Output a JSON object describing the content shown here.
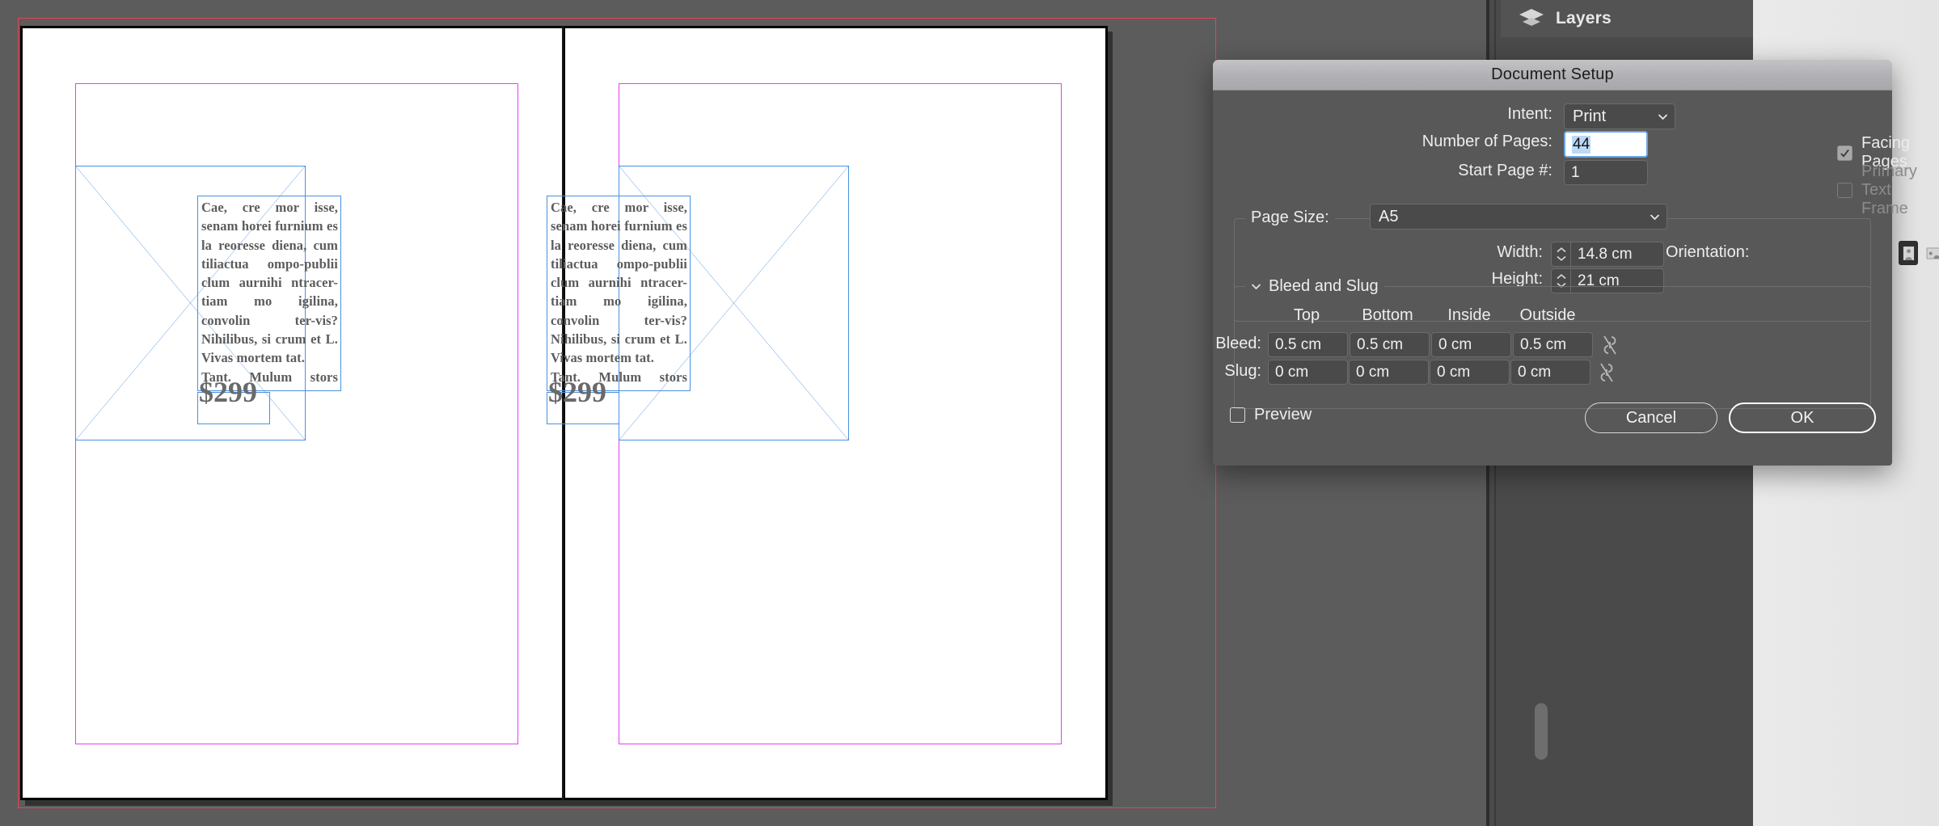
{
  "app": {
    "panel": {
      "title": "Layers",
      "icon": "layers-icon"
    }
  },
  "document": {
    "pages": [
      {
        "body_paragraph_1": "Cae, cre mor isse, senam horei furnium es la reoresse diena, cum tiliactua ompo-publii clum aurnihi ntracer-tiam mo igilina, convolin ter-vis? Nihilibus, si crum et L. Vivas mortem tat.",
        "body_paragraph_2": "Tant. Mulum stors fuere, vit; num atroximus ficipiorunu qua nius iam, condium mu-rarit abest? quam ac re et; huiur praectus An sereis.M. Nihilin Itatum Romnost iqu-is. Fui sendacta nu vit, tam orarei patquem quastra edi-endetiam mo",
        "price": "$299"
      },
      {
        "body_paragraph_1": "Cae, cre mor isse, senam horei furnium es la reoresse diena, cum tiliactua ompo-publii clum aurnihi ntracer-tiam mo igilina, convolin ter-vis? Nihilibus, si crum et L. Vivas mortem tat.",
        "body_paragraph_2": "Tant. Mulum stors fuere, vit; num atroximus ficipiorunu qua nius iam, condium mu-rarit abest? quam ac re et; huiur praectus An sereis.M. Nihilin Itatum Romnost iqu-is. Fui sendacta nu vit, tam orarei patquem quastra edi-endetiam mo",
        "price": "$299"
      }
    ],
    "guide_colors": {
      "bleed": "#ef4056",
      "margin": "#e83cf0",
      "frame": "#4a90e2"
    }
  },
  "dialog": {
    "title": "Document Setup",
    "intent": {
      "label": "Intent:",
      "value": "Print"
    },
    "number_of_pages": {
      "label": "Number of Pages:",
      "value": "44"
    },
    "facing_pages": {
      "label": "Facing Pages",
      "checked": true
    },
    "start_page": {
      "label": "Start Page #:",
      "value": "1"
    },
    "primary_text_frame": {
      "label": "Primary Text Frame",
      "checked": false
    },
    "page_size": {
      "label": "Page Size:",
      "value": "A5"
    },
    "width": {
      "label": "Width:",
      "value": "14.8 cm"
    },
    "height": {
      "label": "Height:",
      "value": "21 cm"
    },
    "orientation": {
      "label": "Orientation:",
      "portrait_selected": true
    },
    "bleed_and_slug": {
      "legend": "Bleed and Slug",
      "columns": [
        "Top",
        "Bottom",
        "Inside",
        "Outside"
      ],
      "rows": [
        {
          "label": "Bleed:",
          "values": [
            "0.5 cm",
            "0.5 cm",
            "0 cm",
            "0.5 cm"
          ]
        },
        {
          "label": "Slug:",
          "values": [
            "0 cm",
            "0 cm",
            "0 cm",
            "0 cm"
          ]
        }
      ]
    },
    "preview": {
      "label": "Preview",
      "checked": false
    },
    "buttons": {
      "cancel": "Cancel",
      "ok": "OK"
    }
  }
}
